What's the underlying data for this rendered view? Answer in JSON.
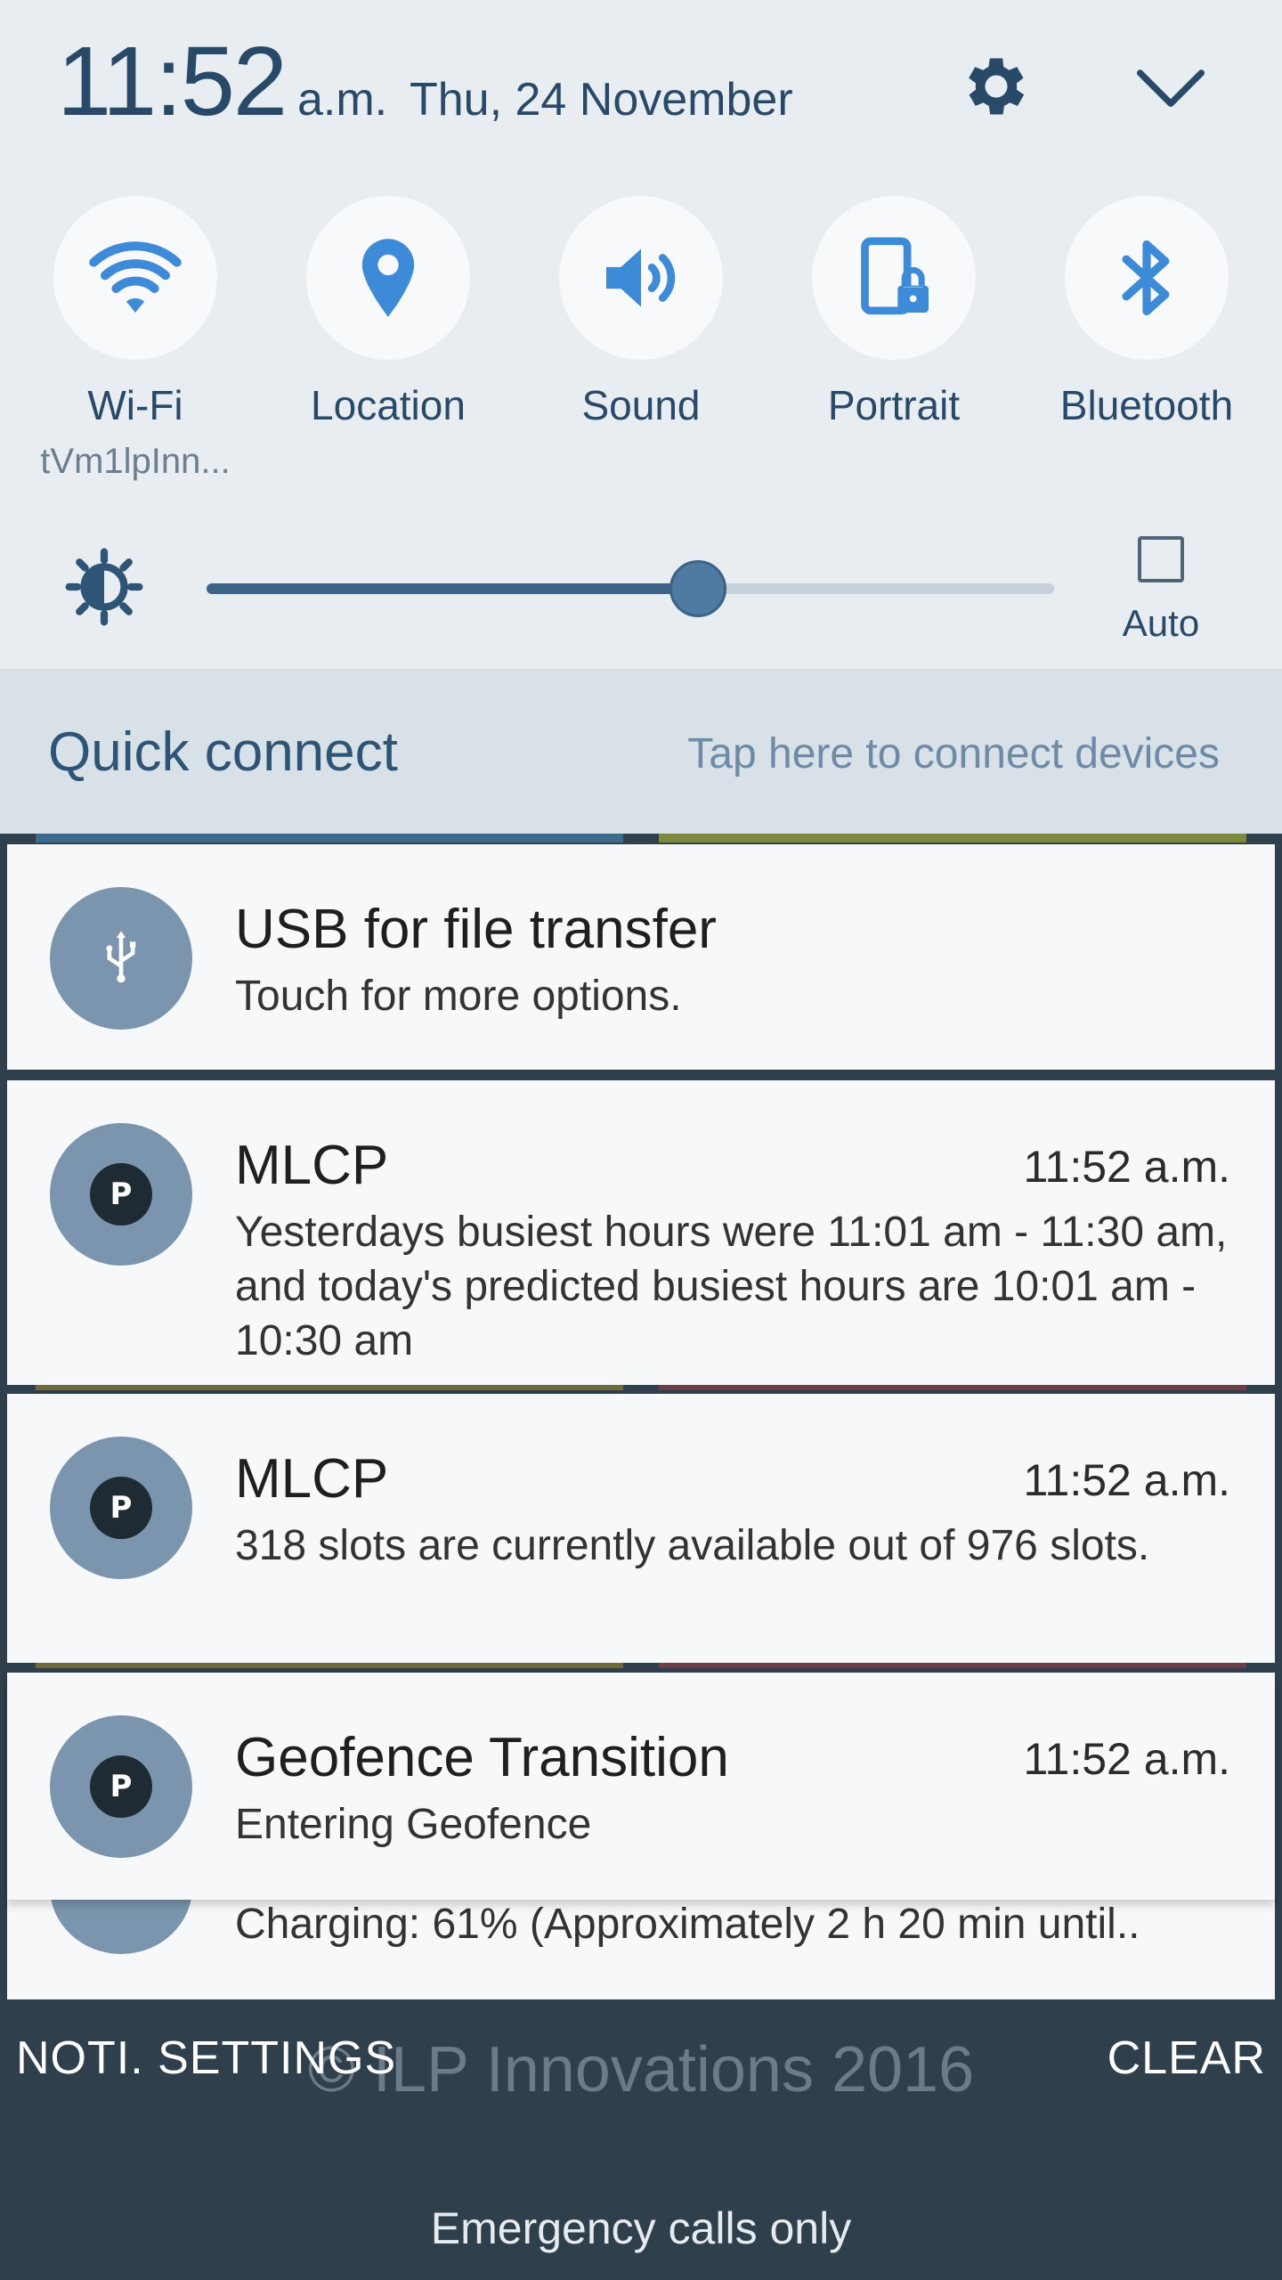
{
  "status": {
    "time": "11:52",
    "ampm": "a.m.",
    "date": "Thu, 24 November"
  },
  "tiles": [
    {
      "label": "Wi-Fi",
      "sub": "tVm1lpInn...",
      "icon": "wifi-icon"
    },
    {
      "label": "Location",
      "sub": "",
      "icon": "location-pin-icon"
    },
    {
      "label": "Sound",
      "sub": "",
      "icon": "speaker-icon"
    },
    {
      "label": "Portrait",
      "sub": "",
      "icon": "screen-rotation-lock-icon"
    },
    {
      "label": "Bluetooth",
      "sub": "",
      "icon": "bluetooth-icon"
    }
  ],
  "brightness": {
    "level": 0.58,
    "auto_label": "Auto",
    "auto_checked": false
  },
  "quick_connect": {
    "title": "Quick connect",
    "hint": "Tap here to connect devices"
  },
  "notifications": {
    "usb": {
      "title": "USB for file transfer",
      "body": "Touch for more options."
    },
    "mlcp1": {
      "title": "MLCP",
      "time": "11:52 a.m.",
      "body": "Yesterdays busiest hours were 11:01 am - 11:30 am, and today's predicted busiest hours are 10:01 am - 10:30 am"
    },
    "mlcp2": {
      "title": "MLCP",
      "time": "11:52 a.m.",
      "body": "318 slots are currently available out of 976 slots."
    },
    "geofence": {
      "title": "Geofence Transition",
      "time": "11:52 a.m.",
      "body": "Entering Geofence"
    },
    "charging": {
      "body": "Charging: 61% (Approximately 2 h 20 min until.."
    },
    "app_badge": "P"
  },
  "footer": {
    "settings_label": "NOTI. SETTINGS",
    "clear_label": "CLEAR",
    "watermark": "© ILP Innovations 2016",
    "emergency": "Emergency calls only"
  },
  "colors": {
    "accent": "#3c8ad8",
    "panel": "#e8edf1",
    "shade": "#2f3f4c"
  }
}
